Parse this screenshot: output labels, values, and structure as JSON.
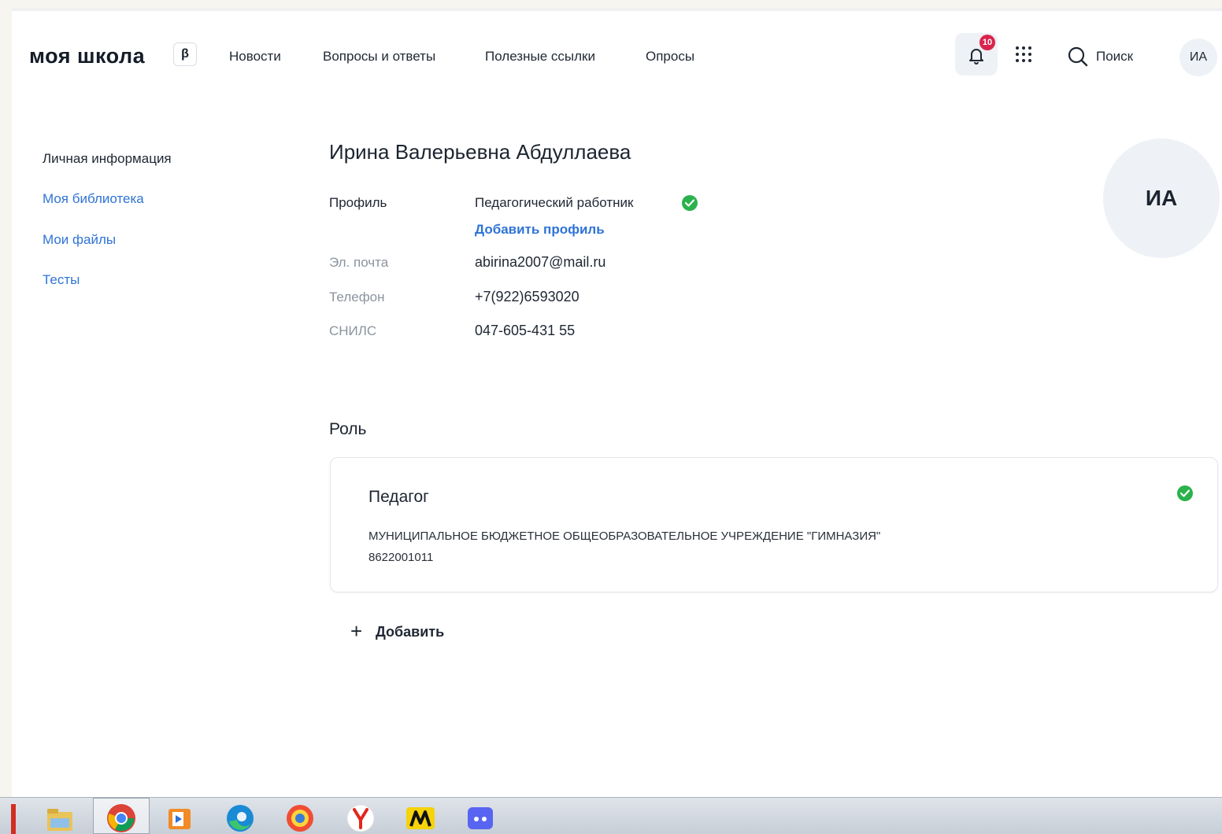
{
  "header": {
    "logo": "моя школа",
    "beta": "β",
    "nav": [
      "Новости",
      "Вопросы и ответы",
      "Полезные ссылки",
      "Опросы"
    ],
    "notification_count": "10",
    "search_label": "Поиск",
    "avatar_initials": "ИА"
  },
  "sidebar": {
    "items": [
      {
        "label": "Личная информация"
      },
      {
        "label": "Моя библиотека"
      },
      {
        "label": "Мои файлы"
      },
      {
        "label": "Тесты"
      }
    ]
  },
  "profile": {
    "full_name": "Ирина Валерьевна Абдуллаева",
    "profile_label": "Профиль",
    "profile_value": "Педагогический работник",
    "add_profile": "Добавить профиль",
    "email_label": "Эл. почта",
    "email_value": "abirina2007@mail.ru",
    "phone_label": "Телефон",
    "phone_value": "+7(922)6593020",
    "snils_label": "СНИЛС",
    "snils_value": "047-605-431 55",
    "avatar_initials": "ИА"
  },
  "role": {
    "title": "Роль",
    "name": "Педагог",
    "organization": "МУНИЦИПАЛЬНОЕ БЮДЖЕТНОЕ ОБЩЕОБРАЗОВАТЕЛЬНОЕ УЧРЕЖДЕНИЕ \"ГИМНАЗИЯ\"",
    "inn": "8622001011",
    "add_button": "Добавить"
  },
  "taskbar": {
    "icons": [
      "file-explorer-icon",
      "chrome-icon",
      "media-player-icon",
      "edge-icon",
      "yandex-browser-icon",
      "yandex-icon",
      "app-m-icon",
      "discord-icon"
    ]
  },
  "colors": {
    "accent_link": "#2f73d6",
    "verified_green": "#2bb24c",
    "badge_red": "#d9254c"
  }
}
